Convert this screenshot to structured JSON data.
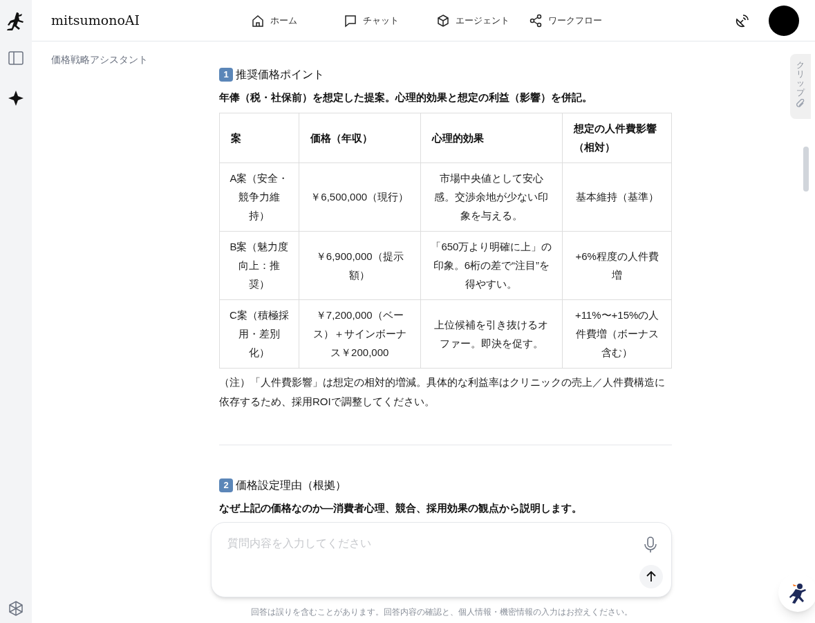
{
  "app": {
    "name": "mitsumonoAI"
  },
  "nav": [
    {
      "kind": "home",
      "label": "ホーム"
    },
    {
      "kind": "chat",
      "label": "チャット"
    },
    {
      "kind": "cube",
      "label": "エージェント"
    },
    {
      "kind": "share",
      "label": "ワークフロー"
    }
  ],
  "page_title": "価格戦略アシスタント",
  "clip_tab": {
    "label": "クリップ"
  },
  "sections": [
    {
      "number": "1",
      "heading": "推奨価格ポイント",
      "lead": "年俸（税・社保前）を想定した提案。心理的効果と想定の利益（影響）を併記。",
      "table": {
        "columns": [
          "案",
          "価格（年収）",
          "心理的効果",
          "想定の人件費影響（相対）"
        ],
        "rows": [
          [
            "A案（安全・競争力維持）",
            "￥6,500,000（現行）",
            "市場中央値として安心感。交渉余地が少ない印象を与える。",
            "基本維持（基準）"
          ],
          [
            "B案（魅力度向上：推奨）",
            "￥6,900,000（提示額）",
            "「650万より明確に上」の印象。6桁の差で“注目”を得やすい。",
            "+6%程度の人件費増"
          ],
          [
            "C案（積極採用・差別化）",
            "￥7,200,000（ベース）＋サインボーナス￥200,000",
            "上位候補を引き抜けるオファー。即決を促す。",
            "+11%〜+15%の人件費増（ボーナス含む）"
          ]
        ]
      },
      "note": "（注）「人件費影響」は想定の相対的増減。具体的な利益率はクリニックの売上／人件費構造に依存するため、採用ROIで調整してください。"
    },
    {
      "number": "2",
      "heading": "価格設定理由（根拠）",
      "lead": "なぜ上記の価格なのか—消費者心理、競合、採用効果の観点から説明します。"
    }
  ],
  "composer": {
    "placeholder": "質問内容を入力してください"
  },
  "disclaimer": "回答は誤りを含むことがあります。回答内容の確認と、個人情報・機密情報の入力はお控えください。"
}
